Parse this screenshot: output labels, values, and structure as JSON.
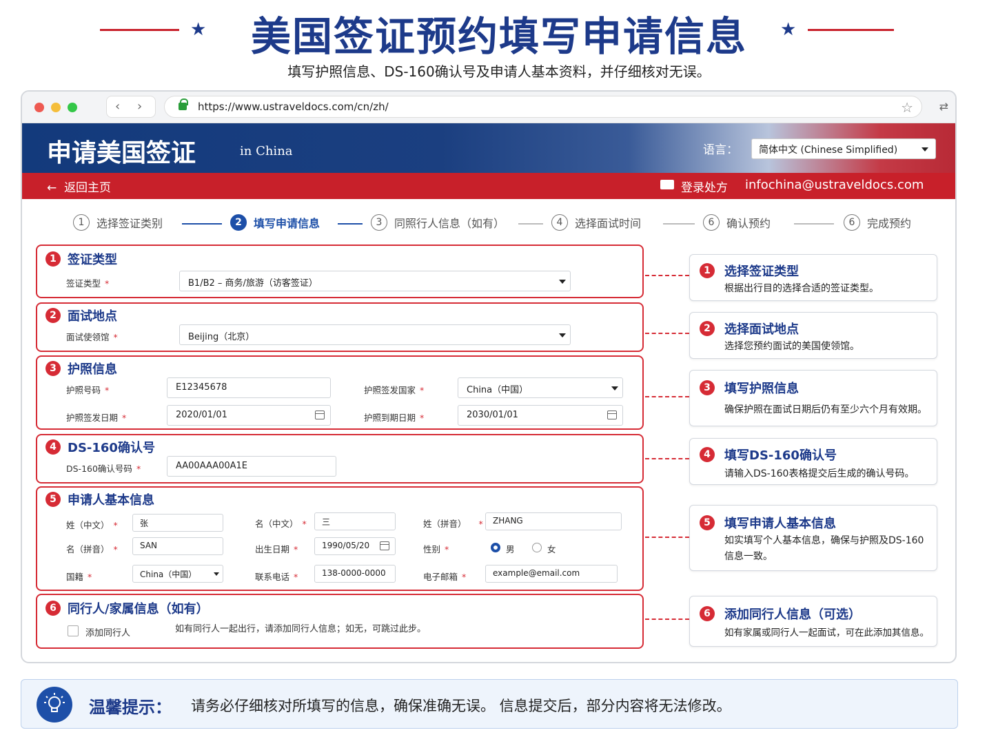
{
  "banner": {
    "title": "美国签证预约填写申请信息",
    "subtitle": "填写护照信息、DS-160确认号及申请人基本资料，并仔细核对无误。"
  },
  "browser": {
    "url": "https://www.ustraveldocs.com/cn/zh/"
  },
  "site": {
    "title": "申请美国签证",
    "subtitle": "in China",
    "language_label": "语言：",
    "language_value": "简体中文 (Chinese Simplified)",
    "back_home": "返回主页",
    "login_label": "登录处方",
    "email": "infochina@ustraveldocs.com"
  },
  "steps": [
    {
      "num": "1",
      "label": "选择签证类别"
    },
    {
      "num": "2",
      "label": "填写申请信息"
    },
    {
      "num": "3",
      "label": "同照行人信息（如有）"
    },
    {
      "num": "4",
      "label": "选择面试时间"
    },
    {
      "num": "6",
      "label": "确认预约"
    },
    {
      "num": "6",
      "label": "完成预约"
    }
  ],
  "sections": {
    "visa_type": {
      "num": "1",
      "title": "签证类型",
      "label": "签证类型",
      "value": "B1/B2 – 商务/旅游（访客签证）"
    },
    "interview": {
      "num": "2",
      "title": "面试地点",
      "label": "面试使领馆",
      "value": "Beijing（北京）"
    },
    "passport": {
      "num": "3",
      "title": "护照信息",
      "number_label": "护照号码",
      "number_value": "E12345678",
      "country_label": "护照签发国家",
      "country_value": "China（中国）",
      "issue_label": "护照签发日期",
      "issue_value": "2020/01/01",
      "expiry_label": "护照到期日期",
      "expiry_value": "2030/01/01"
    },
    "ds160": {
      "num": "4",
      "title": "DS-160确认号",
      "label": "DS-160确认号码",
      "value": "AA00AAA00A1E"
    },
    "applicant": {
      "num": "5",
      "title": "申请人基本信息",
      "surname_cn_label": "姓（中文）",
      "surname_cn_value": "张",
      "given_cn_label": "名（中文）",
      "given_cn_value": "三",
      "surname_py_label": "姓（拼音）",
      "surname_py_value": "ZHANG",
      "given_py_label": "名（拼音）",
      "given_py_value": "SAN",
      "dob_label": "出生日期",
      "dob_value": "1990/05/20",
      "gender_label": "性别",
      "gender_male": "男",
      "gender_female": "女",
      "nationality_label": "国籍",
      "nationality_value": "China（中国）",
      "phone_label": "联系电话",
      "phone_value": "138-0000-0000",
      "email_label": "电子邮箱",
      "email_value": "example@email.com"
    },
    "companion": {
      "num": "6",
      "title": "同行人/家属信息（如有）",
      "checkbox_label": "添加同行人",
      "note": "如有同行人一起出行，请添加同行人信息；如无，可跳过此步。"
    }
  },
  "cards": [
    {
      "num": "1",
      "title": "选择签证类型",
      "desc": "根据出行目的选择合适的签证类型。"
    },
    {
      "num": "2",
      "title": "选择面试地点",
      "desc": "选择您预约面试的美国使领馆。"
    },
    {
      "num": "3",
      "title": "填写护照信息",
      "desc": "确保护照在面试日期后仍有至少六个月有效期。"
    },
    {
      "num": "4",
      "title": "填写DS-160确认号",
      "desc": "请输入DS-160表格提交后生成的确认号码。"
    },
    {
      "num": "5",
      "title": "填写申请人基本信息",
      "desc": "如实填写个人基本信息，确保与护照及DS-160信息一致。"
    },
    {
      "num": "6",
      "title": "添加同行人信息（可选）",
      "desc": "如有家属或同行人一起面试，可在此添加其信息。"
    }
  ],
  "tip": {
    "label": "温馨提示：",
    "text": "请务必仔细核对所填写的信息，确保准确无误。 信息提交后，部分内容将无法修改。"
  },
  "colors": {
    "brand_blue": "#1d3a8a",
    "accent_red": "#c8202a",
    "active_step": "#1d4fa8"
  }
}
